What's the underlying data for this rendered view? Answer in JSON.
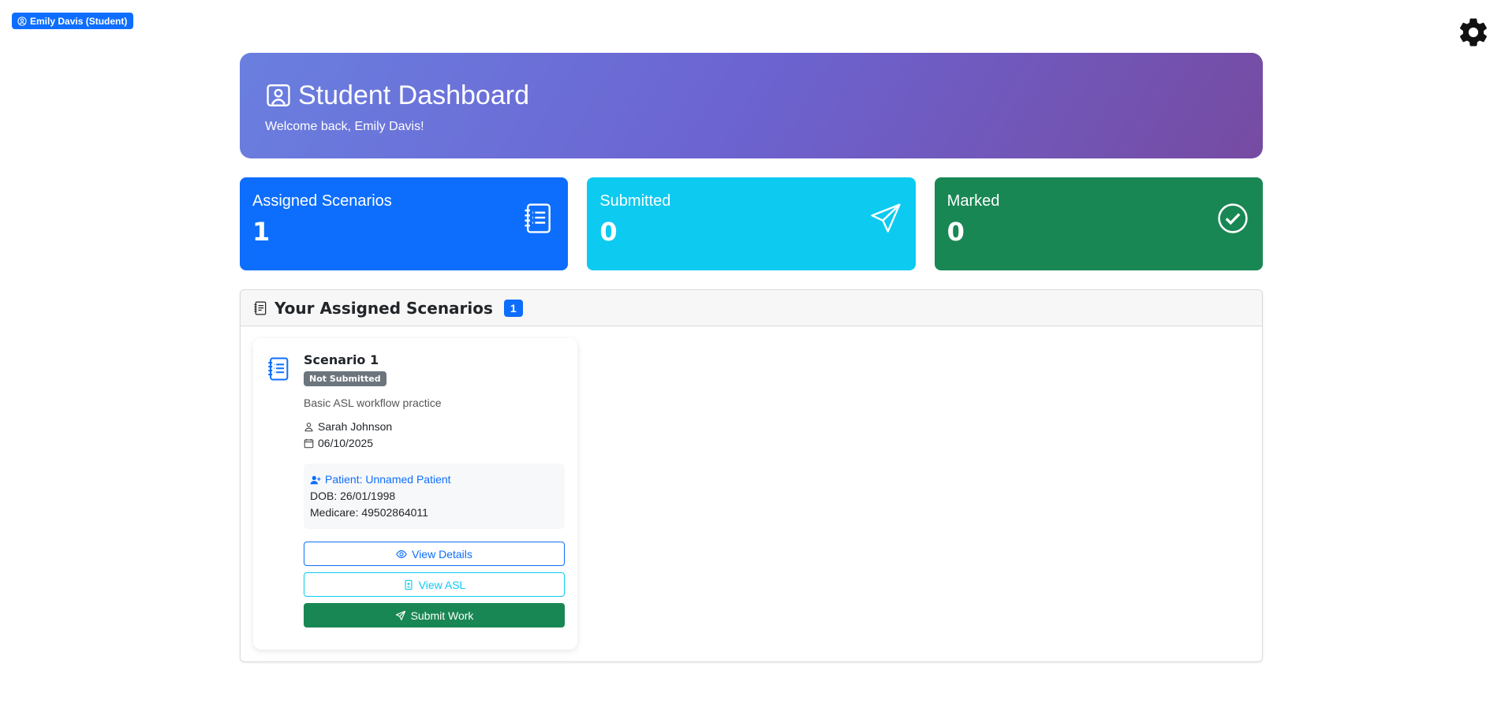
{
  "user_badge": {
    "label": "Emily Davis (Student)",
    "icon": "person-circle-icon"
  },
  "settings": {
    "icon": "gear-icon"
  },
  "hero": {
    "title": "Student Dashboard",
    "subtitle": "Welcome back, Emily Davis!",
    "icon": "person-badge-icon",
    "gradient": [
      "#6a7fe0",
      "#764ba2"
    ]
  },
  "stats": [
    {
      "label": "Assigned Scenarios",
      "value": "1",
      "color": "#0d6efd",
      "icon": "journal-list-icon"
    },
    {
      "label": "Submitted",
      "value": "0",
      "color": "#0dcaf0",
      "icon": "send-icon"
    },
    {
      "label": "Marked",
      "value": "0",
      "color": "#198754",
      "icon": "check-circle-icon"
    }
  ],
  "panel": {
    "title": "Your Assigned Scenarios",
    "count": "1",
    "icon": "journal-text-icon"
  },
  "scenario": {
    "title": "Scenario 1",
    "status": "Not Submitted",
    "description": "Basic ASL workflow practice",
    "author": "Sarah Johnson",
    "date": "06/10/2025",
    "patient_label": "Patient: Unnamed Patient",
    "dob": "DOB: 26/01/1998",
    "medicare": "Medicare: 49502864011",
    "buttons": {
      "view_details": "View Details",
      "view_asl": "View ASL",
      "submit": "Submit Work"
    }
  }
}
